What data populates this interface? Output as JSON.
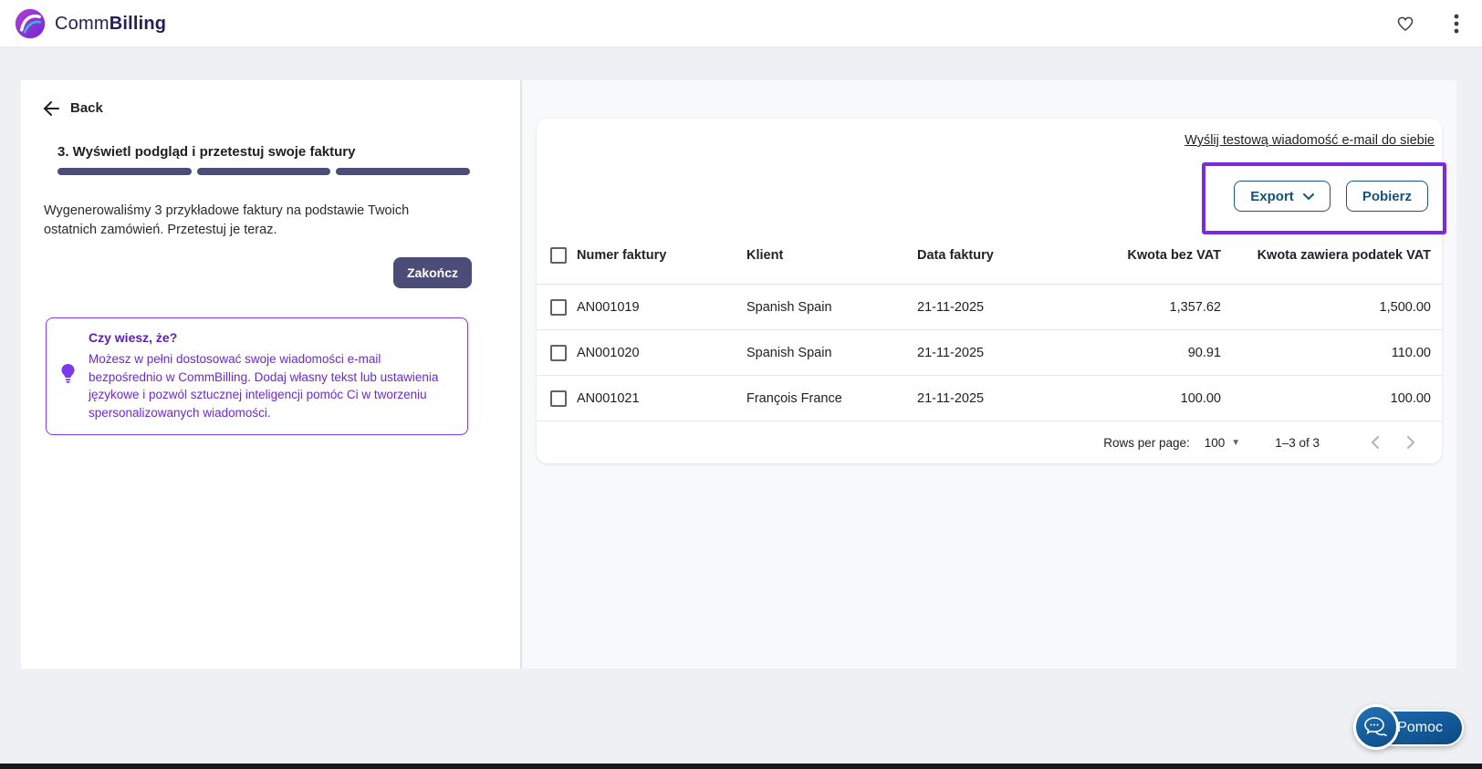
{
  "header": {
    "brand_prefix": "Comm",
    "brand_suffix": "Billing"
  },
  "left_panel": {
    "back_label": "Back",
    "step_title": "3. Wyświetl podgląd i przetestuj swoje faktury",
    "progress_segments": 3,
    "description": "Wygenerowaliśmy 3 przykładowe faktury na podstawie Twoich ostatnich zamówień. Przetestuj je teraz.",
    "finish_button": "Zakończ",
    "tip": {
      "title": "Czy wiesz, że?",
      "body": "Możesz w pełni dostosować swoje wiadomości e-mail bezpośrednio w CommBilling. Dodaj własny tekst lub ustawienia językowe i pozwól sztucznej inteligencji pomóc Ci w tworzeniu spersonalizowanych wiadomości."
    }
  },
  "invoice_panel": {
    "test_email_link": "Wyślij testową wiadomość e-mail do siebie",
    "export_button": "Export",
    "download_button": "Pobierz",
    "table": {
      "columns": [
        "Numer faktury",
        "Klient",
        "Data faktury",
        "Kwota bez VAT",
        "Kwota zawiera podatek VAT"
      ],
      "rows": [
        {
          "numer": "AN001019",
          "klient": "Spanish Spain",
          "data": "21-11-2025",
          "netto": "1,357.62",
          "brutto": "1,500.00"
        },
        {
          "numer": "AN001020",
          "klient": "Spanish Spain",
          "data": "21-11-2025",
          "netto": "90.91",
          "brutto": "110.00"
        },
        {
          "numer": "AN001021",
          "klient": "François France",
          "data": "21-11-2025",
          "netto": "100.00",
          "brutto": "100.00"
        }
      ]
    },
    "pagination": {
      "rows_per_page_label": "Rows per page:",
      "rows_per_page_value": "100",
      "range_label": "1–3 of 3"
    }
  },
  "help_button": {
    "label": "Pomoc"
  },
  "colors": {
    "slate_primary": "#4c4c78",
    "annotation_purple": "#7c2bdb",
    "tip_purple": "#6d28d9",
    "tip_border": "#7c3aed",
    "button_blue": "#17527e",
    "help_blue": "#0d4d86",
    "background_gray": "#eef0f3",
    "panel_light": "#f8f9fb"
  }
}
